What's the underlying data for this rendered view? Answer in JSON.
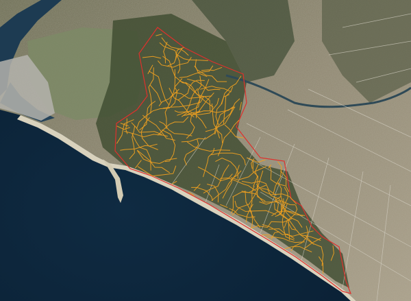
{
  "map": {
    "type": "satellite",
    "colors": {
      "ocean": "#0d2438",
      "ocean_shallow": "#1d3b52",
      "beach": "#d9d2bd",
      "land_dry": "#a59c85",
      "land_dark": "#55583f",
      "farmland": "#7c8a66",
      "pine_forest": "#3d4b2f",
      "urban": "#b4b3ad",
      "river": "#2f4a57",
      "boundary": "#e0302c",
      "trails": "#f0a020",
      "roads": "#d8d4c8"
    },
    "layers": [
      "boundary-polygon",
      "trail-network",
      "road-grid"
    ]
  }
}
